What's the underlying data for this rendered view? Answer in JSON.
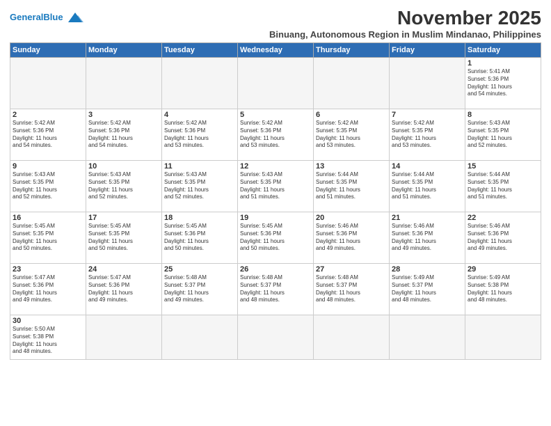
{
  "header": {
    "logo_general": "General",
    "logo_blue": "Blue",
    "month_title": "November 2025",
    "subtitle": "Binuang, Autonomous Region in Muslim Mindanao, Philippines"
  },
  "weekdays": [
    "Sunday",
    "Monday",
    "Tuesday",
    "Wednesday",
    "Thursday",
    "Friday",
    "Saturday"
  ],
  "weeks": [
    [
      {
        "day": "",
        "info": ""
      },
      {
        "day": "",
        "info": ""
      },
      {
        "day": "",
        "info": ""
      },
      {
        "day": "",
        "info": ""
      },
      {
        "day": "",
        "info": ""
      },
      {
        "day": "",
        "info": ""
      },
      {
        "day": "1",
        "info": "Sunrise: 5:41 AM\nSunset: 5:36 PM\nDaylight: 11 hours\nand 54 minutes."
      }
    ],
    [
      {
        "day": "2",
        "info": "Sunrise: 5:42 AM\nSunset: 5:36 PM\nDaylight: 11 hours\nand 54 minutes."
      },
      {
        "day": "3",
        "info": "Sunrise: 5:42 AM\nSunset: 5:36 PM\nDaylight: 11 hours\nand 54 minutes."
      },
      {
        "day": "4",
        "info": "Sunrise: 5:42 AM\nSunset: 5:36 PM\nDaylight: 11 hours\nand 53 minutes."
      },
      {
        "day": "5",
        "info": "Sunrise: 5:42 AM\nSunset: 5:36 PM\nDaylight: 11 hours\nand 53 minutes."
      },
      {
        "day": "6",
        "info": "Sunrise: 5:42 AM\nSunset: 5:35 PM\nDaylight: 11 hours\nand 53 minutes."
      },
      {
        "day": "7",
        "info": "Sunrise: 5:42 AM\nSunset: 5:35 PM\nDaylight: 11 hours\nand 53 minutes."
      },
      {
        "day": "8",
        "info": "Sunrise: 5:43 AM\nSunset: 5:35 PM\nDaylight: 11 hours\nand 52 minutes."
      }
    ],
    [
      {
        "day": "9",
        "info": "Sunrise: 5:43 AM\nSunset: 5:35 PM\nDaylight: 11 hours\nand 52 minutes."
      },
      {
        "day": "10",
        "info": "Sunrise: 5:43 AM\nSunset: 5:35 PM\nDaylight: 11 hours\nand 52 minutes."
      },
      {
        "day": "11",
        "info": "Sunrise: 5:43 AM\nSunset: 5:35 PM\nDaylight: 11 hours\nand 52 minutes."
      },
      {
        "day": "12",
        "info": "Sunrise: 5:43 AM\nSunset: 5:35 PM\nDaylight: 11 hours\nand 51 minutes."
      },
      {
        "day": "13",
        "info": "Sunrise: 5:44 AM\nSunset: 5:35 PM\nDaylight: 11 hours\nand 51 minutes."
      },
      {
        "day": "14",
        "info": "Sunrise: 5:44 AM\nSunset: 5:35 PM\nDaylight: 11 hours\nand 51 minutes."
      },
      {
        "day": "15",
        "info": "Sunrise: 5:44 AM\nSunset: 5:35 PM\nDaylight: 11 hours\nand 51 minutes."
      }
    ],
    [
      {
        "day": "16",
        "info": "Sunrise: 5:45 AM\nSunset: 5:35 PM\nDaylight: 11 hours\nand 50 minutes."
      },
      {
        "day": "17",
        "info": "Sunrise: 5:45 AM\nSunset: 5:35 PM\nDaylight: 11 hours\nand 50 minutes."
      },
      {
        "day": "18",
        "info": "Sunrise: 5:45 AM\nSunset: 5:36 PM\nDaylight: 11 hours\nand 50 minutes."
      },
      {
        "day": "19",
        "info": "Sunrise: 5:45 AM\nSunset: 5:36 PM\nDaylight: 11 hours\nand 50 minutes."
      },
      {
        "day": "20",
        "info": "Sunrise: 5:46 AM\nSunset: 5:36 PM\nDaylight: 11 hours\nand 49 minutes."
      },
      {
        "day": "21",
        "info": "Sunrise: 5:46 AM\nSunset: 5:36 PM\nDaylight: 11 hours\nand 49 minutes."
      },
      {
        "day": "22",
        "info": "Sunrise: 5:46 AM\nSunset: 5:36 PM\nDaylight: 11 hours\nand 49 minutes."
      }
    ],
    [
      {
        "day": "23",
        "info": "Sunrise: 5:47 AM\nSunset: 5:36 PM\nDaylight: 11 hours\nand 49 minutes."
      },
      {
        "day": "24",
        "info": "Sunrise: 5:47 AM\nSunset: 5:36 PM\nDaylight: 11 hours\nand 49 minutes."
      },
      {
        "day": "25",
        "info": "Sunrise: 5:48 AM\nSunset: 5:37 PM\nDaylight: 11 hours\nand 49 minutes."
      },
      {
        "day": "26",
        "info": "Sunrise: 5:48 AM\nSunset: 5:37 PM\nDaylight: 11 hours\nand 48 minutes."
      },
      {
        "day": "27",
        "info": "Sunrise: 5:48 AM\nSunset: 5:37 PM\nDaylight: 11 hours\nand 48 minutes."
      },
      {
        "day": "28",
        "info": "Sunrise: 5:49 AM\nSunset: 5:37 PM\nDaylight: 11 hours\nand 48 minutes."
      },
      {
        "day": "29",
        "info": "Sunrise: 5:49 AM\nSunset: 5:38 PM\nDaylight: 11 hours\nand 48 minutes."
      }
    ],
    [
      {
        "day": "30",
        "info": "Sunrise: 5:50 AM\nSunset: 5:38 PM\nDaylight: 11 hours\nand 48 minutes."
      },
      {
        "day": "",
        "info": ""
      },
      {
        "day": "",
        "info": ""
      },
      {
        "day": "",
        "info": ""
      },
      {
        "day": "",
        "info": ""
      },
      {
        "day": "",
        "info": ""
      },
      {
        "day": "",
        "info": ""
      }
    ]
  ]
}
